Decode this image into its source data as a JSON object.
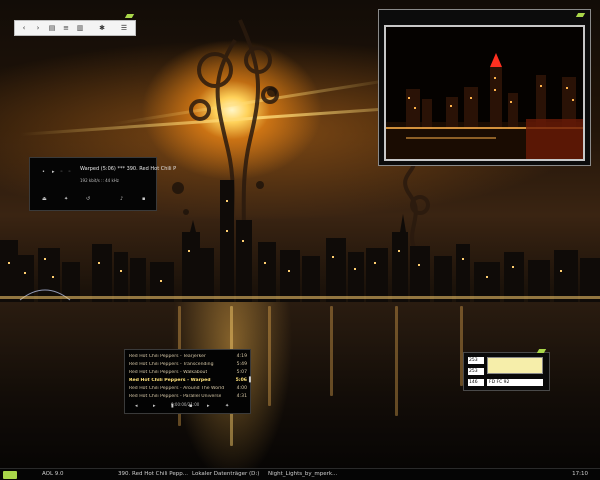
{
  "taskbar": {
    "items": [
      {
        "label": "AOL 9.0"
      },
      {
        "label": "390. Red Hot Chili Pepp..."
      },
      {
        "label": "Lokaler Datenträger (D:)"
      },
      {
        "label": "Night_Lights_by_mperk..."
      }
    ],
    "clock": "17:10"
  },
  "toolbar": {
    "back_icon": "arrow-left-icon",
    "forward_icon": "arrow-right-icon",
    "icons": [
      "list-view-icon",
      "details-view-icon",
      "columns-view-icon",
      "settings-gear-icon",
      "menu-icon"
    ]
  },
  "media": {
    "track": "Warped (5:06) *** 390. Red Hot Chili P",
    "meta": "192 kbit/s :: 44 kHz"
  },
  "playlist": {
    "items": [
      {
        "title": "Red Hot Chili Peppers - Tearjerker",
        "time": "4:19",
        "active": false
      },
      {
        "title": "Red Hot Chili Peppers - Transcending",
        "time": "5:49",
        "active": false
      },
      {
        "title": "Red Hot Chili Peppers - Walkabout",
        "time": "5:07",
        "active": false
      },
      {
        "title": "Red Hot Chili Peppers - Warped",
        "time": "5:06",
        "active": true
      },
      {
        "title": "Red Hot Chili Peppers - Around The World",
        "time": "4:00",
        "active": false
      },
      {
        "title": "Red Hot Chili Peppers - Parallel Universe",
        "time": "4:31",
        "active": false
      }
    ],
    "position": "0:00:00/21:00"
  },
  "calc": {
    "values": [
      "253",
      "253",
      "146"
    ],
    "readout": "FD FC 92"
  },
  "colors": {
    "accent": "#a9d64a",
    "playlist_active": "#ffe27a",
    "note": "#f6eeaa"
  }
}
